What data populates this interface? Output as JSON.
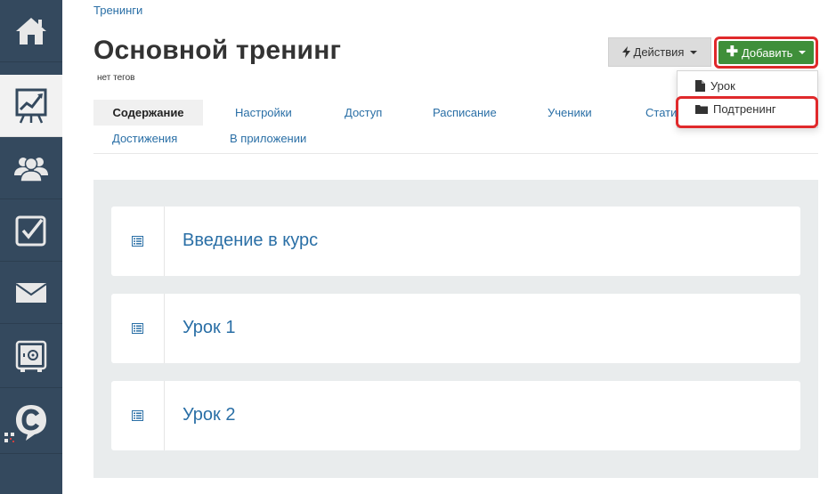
{
  "sidebar": {
    "items": [
      {
        "icon": "home-icon"
      },
      {
        "icon": "chart-board-icon",
        "active": true
      },
      {
        "icon": "users-icon"
      },
      {
        "icon": "checkbox-icon"
      },
      {
        "icon": "mail-icon"
      },
      {
        "icon": "safe-icon"
      },
      {
        "icon": "chat-logo-icon"
      }
    ]
  },
  "breadcrumb": "Тренинги",
  "header": {
    "title": "Основной тренинг",
    "tags": "нет тегов"
  },
  "toolbar": {
    "actions_label": "Действия",
    "add_label": "Добавить"
  },
  "add_menu": {
    "items": [
      {
        "label": "Урок",
        "icon": "file-icon"
      },
      {
        "label": "Подтренинг",
        "icon": "folder-icon"
      }
    ]
  },
  "tabs": [
    {
      "label": "Содержание",
      "active": true
    },
    {
      "label": "Настройки"
    },
    {
      "label": "Доступ"
    },
    {
      "label": "Расписание"
    },
    {
      "label": "Ученики"
    },
    {
      "label": "Стати"
    },
    {
      "label": "Достижения"
    },
    {
      "label": "В приложении"
    }
  ],
  "lessons": [
    {
      "title": "Введение в курс"
    },
    {
      "title": "Урок 1"
    },
    {
      "title": "Урок 2"
    }
  ],
  "colors": {
    "sidebar": "#34495e",
    "link": "#2a6fa6",
    "add_button": "#3f8f3a",
    "highlight": "#e0292b"
  }
}
